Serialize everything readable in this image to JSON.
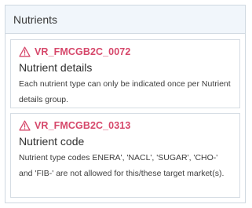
{
  "panel": {
    "title": "Nutrients"
  },
  "validations": [
    {
      "icon": "warning-triangle-icon",
      "code": "VR_FMCGB2C_0072",
      "title": "Nutrient details",
      "description": "Each nutrient type can only be indicated once per Nutrient details group."
    },
    {
      "icon": "warning-triangle-icon",
      "code": "VR_FMCGB2C_0313",
      "title": "Nutrient code",
      "description": "Nutrient type codes ENERA', 'NACL', 'SUGAR', 'CHO-' and 'FIB-' are not allowed for this/these target market(s)."
    }
  ],
  "colors": {
    "accent": "#d6476a",
    "header_bg": "#f1f6fb",
    "border": "#cfd8e0"
  }
}
